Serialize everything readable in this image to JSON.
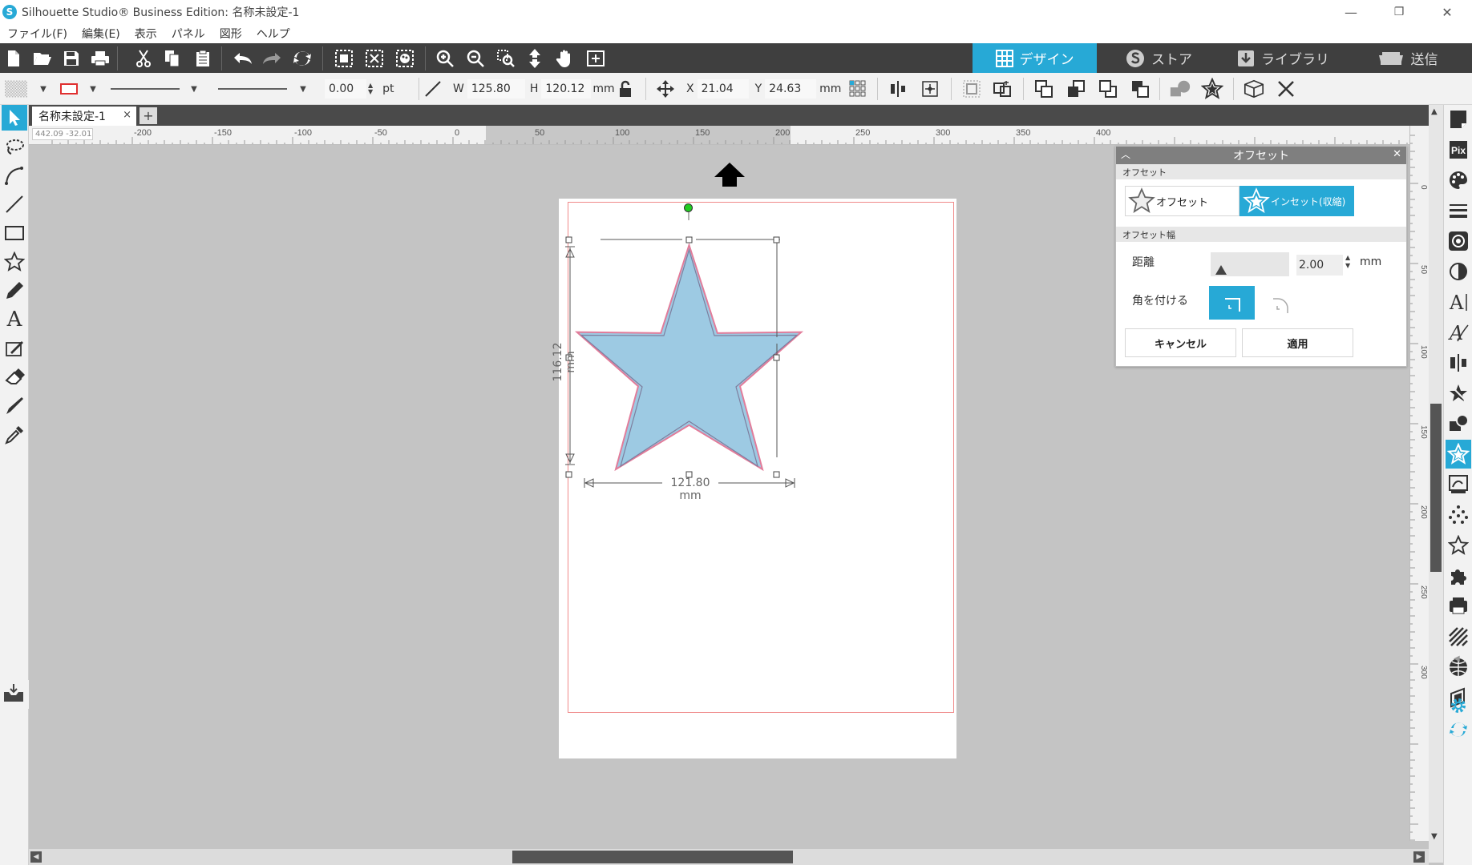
{
  "window": {
    "title": "Silhouette Studio® Business Edition: 名称未設定-1",
    "minimize": "—",
    "restore": "❐",
    "close": "✕"
  },
  "menu": [
    "ファイル(F)",
    "編集(E)",
    "表示",
    "パネル",
    "図形",
    "ヘルプ"
  ],
  "main_tabs": [
    {
      "label": "デザイン",
      "active": true
    },
    {
      "label": "ストア",
      "active": false
    },
    {
      "label": "ライブラリ",
      "active": false
    },
    {
      "label": "送信",
      "active": false
    }
  ],
  "line_props": {
    "width_value": "0.00",
    "width_unit": "pt"
  },
  "size": {
    "w_label": "W",
    "w_value": "125.80",
    "h_label": "H",
    "h_value": "120.12",
    "unit": "mm"
  },
  "position": {
    "x_label": "X",
    "x_value": "21.04",
    "y_label": "Y",
    "y_value": "24.63",
    "unit": "mm"
  },
  "document": {
    "tab_label": "名称未設定-1",
    "close": "×",
    "add": "+"
  },
  "ruler": {
    "corner_readout": "442.09 -32.01",
    "h_labels": [
      "-200",
      "-150",
      "-100",
      "-50",
      "0",
      "50",
      "100",
      "150",
      "200",
      "250",
      "300",
      "350",
      "400"
    ],
    "v_labels": [
      "0",
      "50",
      "100",
      "150",
      "200",
      "250",
      "300"
    ]
  },
  "shape": {
    "width_label": "121.80 mm",
    "height_label": "116.12 mm",
    "fill": "#9dcae3",
    "stroke": "#e27c9a",
    "inner_stroke": "#7e7e9e"
  },
  "offset_panel": {
    "title": "オフセット",
    "section_offset": "オフセット",
    "offset_btn": "オフセット",
    "inset_btn": "インセット(収縮)",
    "section_width": "オフセット幅",
    "distance_label": "距離",
    "distance_value": "2.00",
    "distance_unit": "mm",
    "corner_label": "角を付ける",
    "cancel": "キャンセル",
    "apply": "適用"
  },
  "colors": {
    "accent": "#27a9d6",
    "toolbar_dark": "#3f3f3f"
  }
}
